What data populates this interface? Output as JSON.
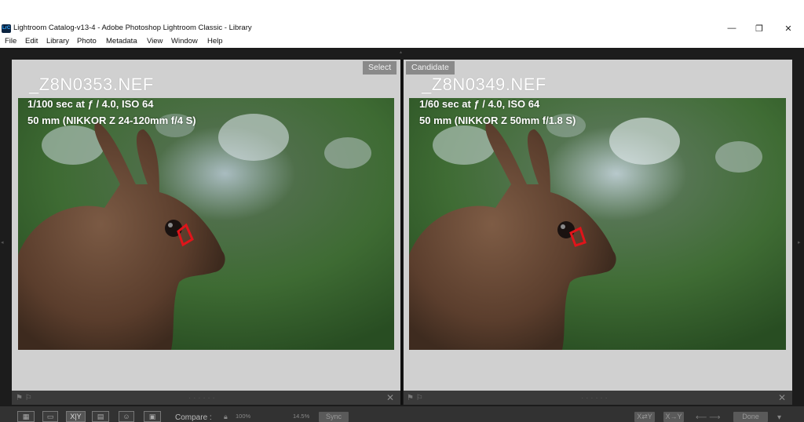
{
  "window": {
    "icon_text": "LrC",
    "title": "Lightroom Catalog-v13-4 - Adobe Photoshop Lightroom Classic - Library",
    "minimize_glyph": "—",
    "restore_glyph": "❐",
    "close_glyph": "✕"
  },
  "menu": [
    "File",
    "Edit",
    "Library",
    "Photo",
    "Metadata",
    "View",
    "Window",
    "Help"
  ],
  "compare": {
    "left": {
      "tag": "Select",
      "filename": "_Z8N0353.NEF",
      "exposure": "1/100 sec at ƒ / 4.0, ISO 64",
      "lens": "50 mm (NIKKOR Z 24-120mm f/4 S)"
    },
    "right": {
      "tag": "Candidate",
      "filename": "_Z8N0349.NEF",
      "exposure": "1/60 sec at ƒ / 4.0, ISO 64",
      "lens": "50 mm (NIKKOR Z 50mm f/1.8 S)"
    }
  },
  "footer": {
    "flag_icons": "⚑ ⚐",
    "dots": "· · · · · ·",
    "close": "✕"
  },
  "toolbar": {
    "compare_label": "Compare :",
    "zoom_left": "100%",
    "zoom_right": "14.5%",
    "sync_label": "Sync",
    "xy_label": "X|Y",
    "done_label": "Done",
    "swap_label": "X⇄Y",
    "make_select_label": "X→Y",
    "arrows": "⟵ ⟶"
  }
}
